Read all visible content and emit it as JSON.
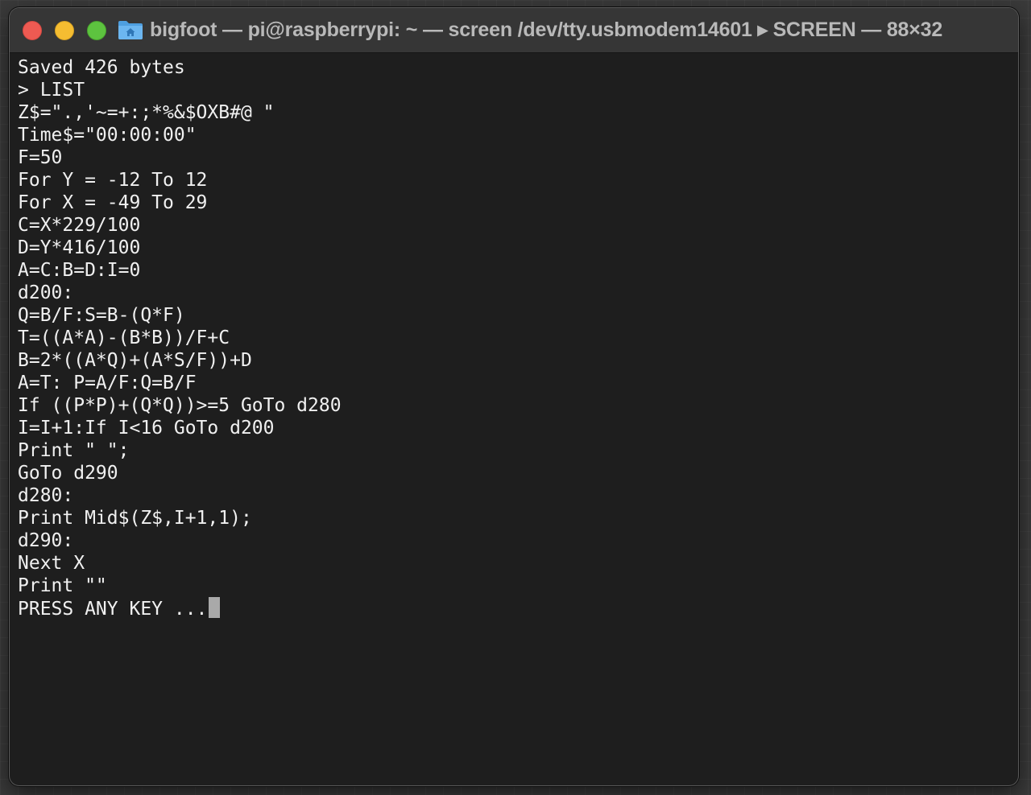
{
  "window": {
    "title": "bigfoot — pi@raspberrypi: ~ — screen /dev/tty.usbmodem14601 ▸ SCREEN — 88×32",
    "folder_icon": "folder-home-icon",
    "buttons": {
      "close": "close-icon",
      "minimize": "minimize-icon",
      "maximize": "maximize-icon"
    }
  },
  "terminal": {
    "lines": [
      "Saved 426 bytes",
      "> LIST",
      "Z$=\".,'~=+:;*%&$OXB#@ \"",
      "Time$=\"00:00:00\"",
      "F=50",
      "For Y = -12 To 12",
      "For X = -49 To 29",
      "C=X*229/100",
      "D=Y*416/100",
      "A=C:B=D:I=0",
      "d200:",
      "Q=B/F:S=B-(Q*F)",
      "T=((A*A)-(B*B))/F+C",
      "B=2*((A*Q)+(A*S/F))+D",
      "A=T: P=A/F:Q=B/F",
      "If ((P*P)+(Q*Q))>=5 GoTo d280",
      "I=I+1:If I<16 GoTo d200",
      "Print \" \";",
      "GoTo d290",
      "d280:",
      "Print Mid$(Z$,I+1,1);",
      "d290:",
      "Next X",
      "Print \"\"",
      "PRESS ANY KEY ..."
    ]
  },
  "colors": {
    "background": "#1e1e1e",
    "titlebar": "#363636",
    "text": "#f0f0f0",
    "title_text": "#b9b9b9",
    "cursor": "#a9a9a9",
    "close": "#ee5a52",
    "minimize": "#f5bd31",
    "maximize": "#5dc33f",
    "folder": "#5aa9e6"
  }
}
